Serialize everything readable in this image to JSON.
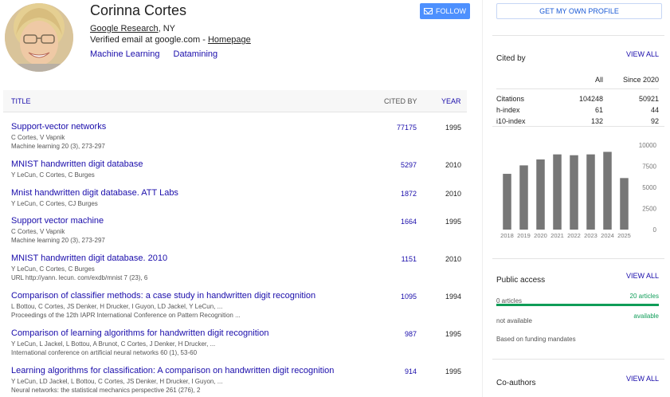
{
  "profile": {
    "name": "Corinna Cortes",
    "affiliation_link": "Google Research",
    "affiliation_rest": ", NY",
    "verified": "Verified email at google.com - ",
    "homepage": "Homepage",
    "interests": [
      "Machine Learning",
      "Datamining"
    ]
  },
  "buttons": {
    "follow": "FOLLOW",
    "get_profile": "GET MY OWN PROFILE"
  },
  "table": {
    "headers": {
      "title": "TITLE",
      "cited_by": "CITED BY",
      "year": "YEAR"
    },
    "rows": [
      {
        "title": "Support-vector networks",
        "authors": "C Cortes, V Vapnik",
        "venue": "Machine learning 20 (3), 273-297",
        "cited": "77175",
        "year": "1995"
      },
      {
        "title": "MNIST handwritten digit database",
        "authors": "Y LeCun, C Cortes, C Burges",
        "venue": "",
        "cited": "5297",
        "year": "2010"
      },
      {
        "title": "Mnist handwritten digit database. ATT Labs",
        "authors": "Y LeCun, C Cortes, CJ Burges",
        "venue": "",
        "cited": "1872",
        "year": "2010"
      },
      {
        "title": "Support vector machine",
        "authors": "C Cortes, V Vapnik",
        "venue": "Machine learning 20 (3), 273-297",
        "cited": "1664",
        "year": "1995"
      },
      {
        "title": "MNIST handwritten digit database. 2010",
        "authors": "Y LeCun, C Cortes, C Burges",
        "venue": "URL http://yann. lecun. com/exdb/mnist 7 (23), 6",
        "cited": "1151",
        "year": "2010"
      },
      {
        "title": "Comparison of classifier methods: a case study in handwritten digit recognition",
        "authors": "L Bottou, C Cortes, JS Denker, H Drucker, I Guyon, LD Jackel, Y LeCun, ...",
        "venue": "Proceedings of the 12th IAPR International Conference on Pattern Recognition ...",
        "cited": "1095",
        "year": "1994"
      },
      {
        "title": "Comparison of learning algorithms for handwritten digit recognition",
        "authors": "Y LeCun, L Jackel, L Bottou, A Brunot, C Cortes, J Denker, H Drucker, ...",
        "venue": "International conference on artificial neural networks 60 (1), 53-60",
        "cited": "987",
        "year": "1995"
      },
      {
        "title": "Learning algorithms for classification: A comparison on handwritten digit recognition",
        "authors": "Y LeCun, LD Jackel, L Bottou, C Cortes, JS Denker, H Drucker, I Guyon, ...",
        "venue": "Neural networks: the statistical mechanics perspective 261 (276), 2",
        "cited": "914",
        "year": "1995"
      }
    ]
  },
  "cited_by": {
    "title": "Cited by",
    "view_all": "VIEW ALL",
    "col_all": "All",
    "col_since": "Since 2020",
    "stats": [
      {
        "label": "Citations",
        "all": "104248",
        "since": "50921"
      },
      {
        "label": "h-index",
        "all": "61",
        "since": "44"
      },
      {
        "label": "i10-index",
        "all": "132",
        "since": "92"
      }
    ]
  },
  "chart_data": {
    "type": "bar",
    "categories": [
      "2018",
      "2019",
      "2020",
      "2021",
      "2022",
      "2023",
      "2024",
      "2025"
    ],
    "values": [
      6600,
      7600,
      8300,
      8900,
      8800,
      8900,
      9200,
      6100
    ],
    "yticks": [
      "10000",
      "7500",
      "5000",
      "2500",
      "0"
    ],
    "ylim": [
      0,
      10000
    ],
    "color": "#777777"
  },
  "public_access": {
    "title": "Public access",
    "view_all": "VIEW ALL",
    "left_count": "0 articles",
    "right_count": "20 articles",
    "left_status": "not available",
    "right_status": "available",
    "note": "Based on funding mandates",
    "accent": "#0f9d58"
  },
  "coauthors": {
    "title": "Co-authors",
    "view_all": "VIEW ALL"
  }
}
